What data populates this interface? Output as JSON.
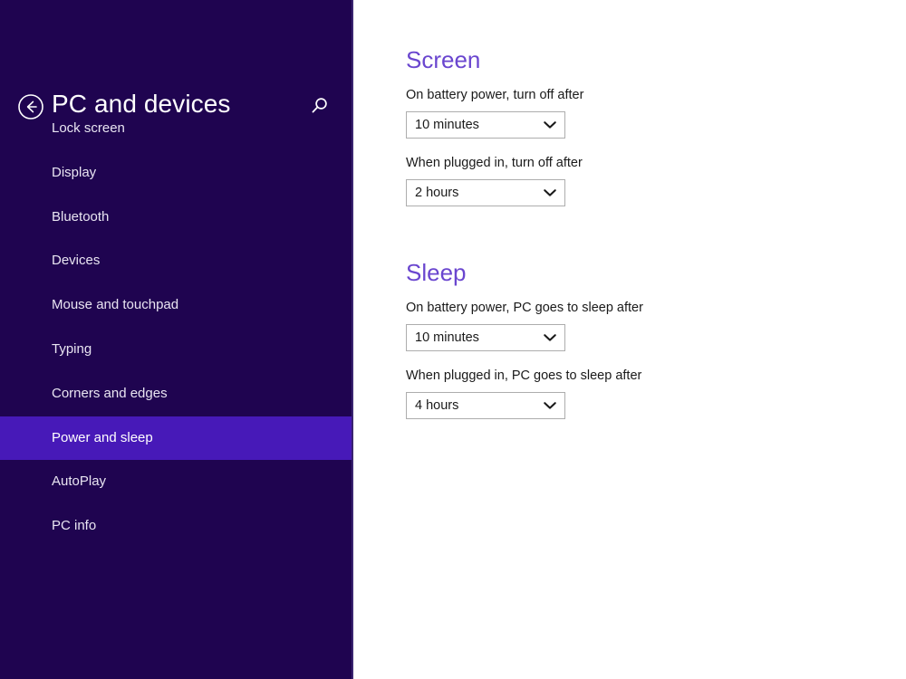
{
  "sidebar": {
    "back_icon": "back-arrow-circle-icon",
    "title": "PC and devices",
    "search_icon": "search-icon",
    "items": [
      {
        "label": "Lock screen",
        "selected": false
      },
      {
        "label": "Display",
        "selected": false
      },
      {
        "label": "Bluetooth",
        "selected": false
      },
      {
        "label": "Devices",
        "selected": false
      },
      {
        "label": "Mouse and touchpad",
        "selected": false
      },
      {
        "label": "Typing",
        "selected": false
      },
      {
        "label": "Corners and edges",
        "selected": false
      },
      {
        "label": "Power and sleep",
        "selected": true
      },
      {
        "label": "AutoPlay",
        "selected": false
      },
      {
        "label": "PC info",
        "selected": false
      }
    ]
  },
  "content": {
    "sections": [
      {
        "heading": "Screen",
        "fields": [
          {
            "label": "On battery power, turn off after",
            "value": "10 minutes",
            "chevron_icon": "chevron-down-icon"
          },
          {
            "label": "When plugged in, turn off after",
            "value": "2 hours",
            "chevron_icon": "chevron-down-icon"
          }
        ]
      },
      {
        "heading": "Sleep",
        "fields": [
          {
            "label": "On battery power, PC goes to sleep after",
            "value": "10 minutes",
            "chevron_icon": "chevron-down-icon"
          },
          {
            "label": "When plugged in, PC goes to sleep after",
            "value": "4 hours",
            "chevron_icon": "chevron-down-icon"
          }
        ]
      }
    ]
  },
  "colors": {
    "sidebar_background": "#1f0450",
    "selected_item": "#4719b8",
    "heading_purple": "#6a46cf",
    "content_background": "#ffffff",
    "dropdown_border": "#adadad",
    "text_light": "#e9e5f2",
    "text_dark": "#1a1a1a"
  }
}
